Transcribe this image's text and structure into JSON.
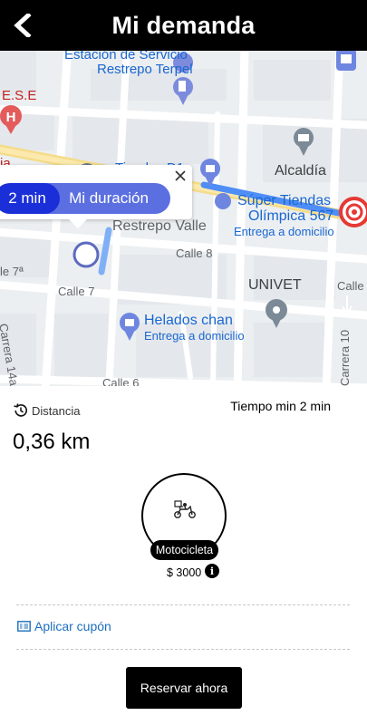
{
  "header": {
    "title": "Mi demanda",
    "back_icon": "chevron-left-icon"
  },
  "map": {
    "labels": {
      "station_1": "Estación de Servicio",
      "station_2": "Restrepo Terpel",
      "hospital": "E.S.E",
      "hospital_partial": "ia",
      "tiendas_d1": "Tiendas D1",
      "alcaldia": "Alcaldía",
      "olimpica_1": "Súper Tiendas",
      "olimpica_2": "Olímpica 567",
      "olimpica_sub": "Entrega a domicilio",
      "restrepo_valle": "Restrepo Valle",
      "calle_8": "Calle 8",
      "calle_7a": "le 7ª",
      "calle_7": "Calle 7",
      "univet": "UNIVET",
      "calle_e": "Calle",
      "carrera_14a": "Carrera 14a",
      "helados": "Helados chan",
      "helados_sub": "Entrega a domicilio",
      "carrera_10": "Carrera 10",
      "calle_6": "Calle 6"
    },
    "route_popup": {
      "time": "2 min",
      "label": "Mi duración",
      "close_icon": "close-icon"
    },
    "colors": {
      "route": "#4f8df7",
      "origin": "#5c6bc0",
      "destination": "#e53935"
    }
  },
  "trip": {
    "distance_label": "Distancia",
    "distance_icon": "history-icon",
    "distance_value": "0,36 km",
    "time_min": "Tiempo min 2 min"
  },
  "vehicle": {
    "icon": "motorcycle-delivery-icon",
    "name": "Motocicleta",
    "price": "$ 3000",
    "info_icon": "info-icon",
    "info_symbol": "i"
  },
  "coupon": {
    "icon": "coupon-icon",
    "label": "Aplicar cupón"
  },
  "actions": {
    "reserve_label": "Reservar ahora"
  }
}
